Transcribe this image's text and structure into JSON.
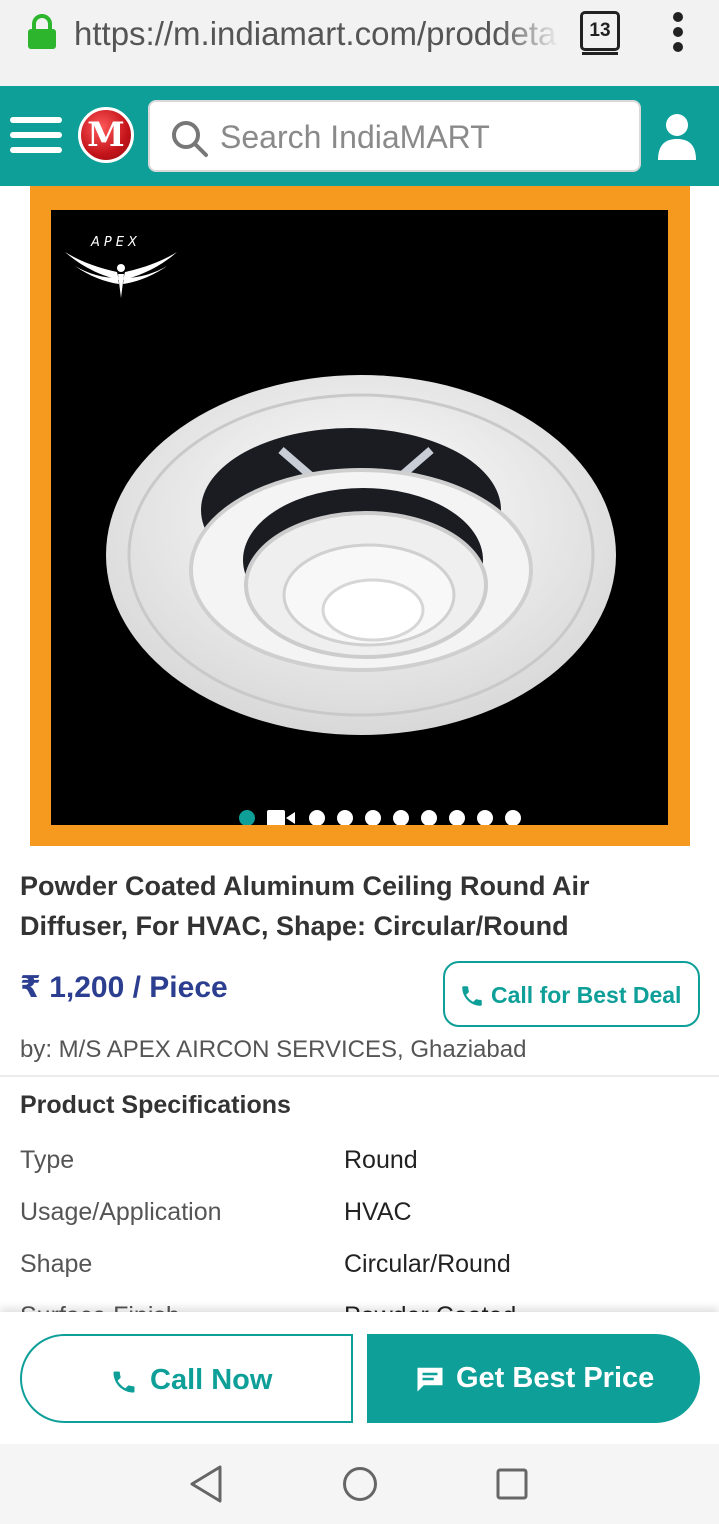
{
  "browser": {
    "url": "https://m.indiamart.com/proddeta",
    "tab_count": "13",
    "icons": {
      "lock": "lock-icon",
      "tabs": "tab-switcher-icon",
      "menu": "more-vertical-icon"
    }
  },
  "header": {
    "logo_text": "M",
    "search_placeholder": "Search IndiaMART",
    "icons": {
      "menu": "hamburger-menu-icon",
      "search": "search-icon",
      "account": "user-icon"
    },
    "colors": {
      "bar": "#0e9f98",
      "logo": "#c4141a"
    }
  },
  "gallery": {
    "brand_text": "APEX",
    "image_subject": "white round ceiling air diffuser on black background",
    "frame_color": "#f59a1e",
    "slide_count": 10,
    "active_slide": 1,
    "video_slide": 2
  },
  "product": {
    "title": "Powder Coated Aluminum Ceiling Round Air Diffuser, For HVAC, Shape: Circular/Round",
    "price": "₹ 1,200 / Piece",
    "deal_button": "Call for Best Deal",
    "seller": "by: M/S APEX AIRCON SERVICES, Ghaziabad",
    "price_color": "#2c3e8f"
  },
  "specs": {
    "heading": "Product Specifications",
    "rows": [
      {
        "key": "Type",
        "value": "Round"
      },
      {
        "key": "Usage/Application",
        "value": "HVAC"
      },
      {
        "key": "Shape",
        "value": "Circular/Round"
      },
      {
        "key": "Surface Finish",
        "value": "Powder Coated"
      }
    ]
  },
  "actions": {
    "call_now": "Call Now",
    "get_best_price": "Get Best Price",
    "icons": {
      "call": "phone-icon",
      "price": "chat-icon"
    },
    "accent": "#0e9f98"
  },
  "system_nav": {
    "icons": {
      "back": "back-triangle-icon",
      "home": "home-circle-icon",
      "recents": "recents-square-icon"
    }
  }
}
